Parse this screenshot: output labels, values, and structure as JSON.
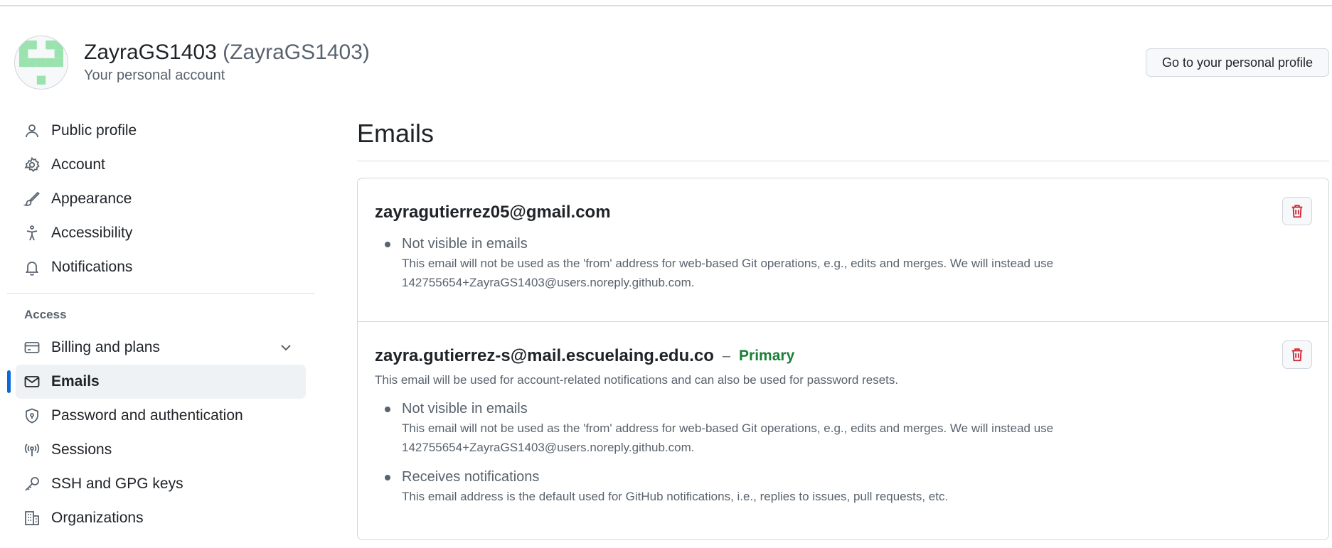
{
  "header": {
    "display_name": "ZayraGS1403",
    "login": "(ZayraGS1403)",
    "subtitle": "Your personal account",
    "profile_button": "Go to your personal profile"
  },
  "sidebar": {
    "items": [
      {
        "label": "Public profile",
        "icon": "person-icon"
      },
      {
        "label": "Account",
        "icon": "gear-icon"
      },
      {
        "label": "Appearance",
        "icon": "paintbrush-icon"
      },
      {
        "label": "Accessibility",
        "icon": "accessibility-icon"
      },
      {
        "label": "Notifications",
        "icon": "bell-icon"
      }
    ],
    "access_title": "Access",
    "access_items": [
      {
        "label": "Billing and plans",
        "icon": "credit-card-icon"
      },
      {
        "label": "Emails",
        "icon": "mail-icon",
        "active": true
      },
      {
        "label": "Password and authentication",
        "icon": "shield-lock-icon"
      },
      {
        "label": "Sessions",
        "icon": "broadcast-icon"
      },
      {
        "label": "SSH and GPG keys",
        "icon": "key-icon"
      },
      {
        "label": "Organizations",
        "icon": "organization-icon"
      }
    ]
  },
  "main": {
    "title": "Emails",
    "emails": [
      {
        "address": "zayragutierrez05@gmail.com",
        "bullets": [
          {
            "title": "Not visible in emails",
            "text": "This email will not be used as the 'from' address for web-based Git operations, e.g., edits and merges. We will instead use 142755654+ZayraGS1403@users.noreply.github.com."
          }
        ]
      },
      {
        "address": "zayra.gutierrez-s@mail.escuelaing.edu.co",
        "dash": "–",
        "badge": "Primary",
        "description": "This email will be used for account-related notifications and can also be used for password resets.",
        "bullets": [
          {
            "title": "Not visible in emails",
            "text": "This email will not be used as the 'from' address for web-based Git operations, e.g., edits and merges. We will instead use 142755654+ZayraGS1403@users.noreply.github.com."
          },
          {
            "title": "Receives notifications",
            "text": "This email address is the default used for GitHub notifications, i.e., replies to issues, pull requests, etc."
          }
        ]
      }
    ]
  },
  "colors": {
    "accent": "#0969da",
    "primary_badge": "#1a7f37",
    "danger": "#d1242f",
    "avatar": "#9be3ae"
  }
}
